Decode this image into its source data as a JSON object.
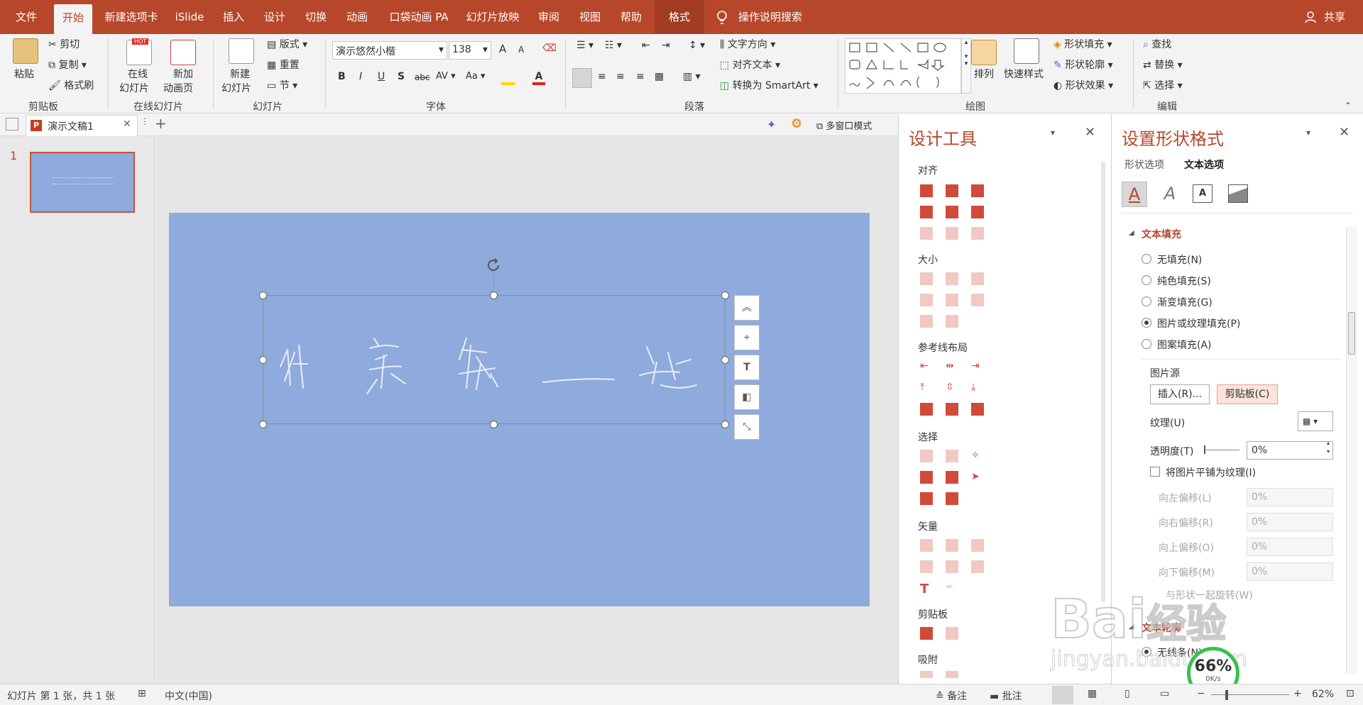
{
  "ribbon_tabs": [
    "文件",
    "开始",
    "新建选项卡",
    "iSlide",
    "插入",
    "设计",
    "切换",
    "动画",
    "口袋动画 PA",
    "幻灯片放映",
    "审阅",
    "视图",
    "帮助",
    "格式"
  ],
  "tell_me": "操作说明搜索",
  "share": "共享",
  "clipboard": {
    "paste": "粘贴",
    "cut": "剪切",
    "copy": "复制",
    "painter": "格式刷",
    "label": "剪贴板"
  },
  "online": {
    "online_slide": "在线",
    "online_slide2": "幻灯片",
    "new_anim": "新加",
    "new_anim2": "动画页",
    "label": "在线幻灯片",
    "hot": "HOT"
  },
  "slides": {
    "new_slide": "新建",
    "new_slide2": "幻灯片",
    "layout": "版式",
    "reset": "重置",
    "section": "节",
    "label": "幻灯片"
  },
  "font": {
    "name": "演示悠然小楷",
    "size": "138",
    "label": "字体",
    "bold": "B",
    "italic": "I",
    "underline": "U",
    "shadow": "S",
    "strike": "abc",
    "spacing": "AV",
    "case": "Aa",
    "grow": "A",
    "shrink": "A"
  },
  "paragraph": {
    "direction": "文字方向",
    "align_text": "对齐文本",
    "smartart": "转换为 SmartArt",
    "label": "段落"
  },
  "drawing": {
    "arrange": "排列",
    "quick_styles": "快速样式",
    "fill": "形状填充",
    "outline": "形状轮廓",
    "effects": "形状效果",
    "label": "绘图"
  },
  "editing": {
    "find": "查找",
    "replace": "替换",
    "select": "选择",
    "label": "编辑"
  },
  "doc_tab": "演示文稿1",
  "multi_window": "多窗口模式",
  "slide_number": "1",
  "design_pane": {
    "title": "设计工具",
    "sections": [
      "对齐",
      "大小",
      "参考线布局",
      "选择",
      "矢量",
      "剪贴板",
      "吸附"
    ]
  },
  "format_pane": {
    "title": "设置形状格式",
    "tab_shape": "形状选项",
    "tab_text": "文本选项",
    "section_fill": "文本填充",
    "fill_options": [
      "无填充(N)",
      "纯色填充(S)",
      "渐变填充(G)",
      "图片或纹理填充(P)",
      "图案填充(A)"
    ],
    "selected_fill": "图片或纹理填充(P)",
    "picture_source": "图片源",
    "insert_btn": "插入(R)...",
    "clipboard_btn": "剪贴板(C)",
    "texture": "纹理(U)",
    "transparency": "透明度(T)",
    "transparency_value": "0%",
    "tile": "将图片平铺为纹理(I)",
    "offsets": [
      {
        "label": "向左偏移(L)",
        "value": "0%"
      },
      {
        "label": "向右偏移(R)",
        "value": "0%"
      },
      {
        "label": "向上偏移(O)",
        "value": "0%"
      },
      {
        "label": "向下偏移(M)",
        "value": "0%"
      }
    ],
    "rotate_with": "与形状一起旋转(W)",
    "section_outline": "文本轮廓",
    "no_line": "无线条(N)"
  },
  "status": {
    "slide_info": "幻灯片 第 1 张，共 1 张",
    "language": "中文(中国)",
    "notes": "备注",
    "comments": "批注",
    "zoom": "62%",
    "speed_pct": "66%",
    "speed": "0K/s"
  },
  "watermark": {
    "brand": "Bai",
    "brand2": "经验",
    "url": "jingyan.baidu.com"
  },
  "colors": {
    "accent": "#b7472a",
    "slide_bg": "#8faadc",
    "icon_red": "#d04a3a"
  }
}
